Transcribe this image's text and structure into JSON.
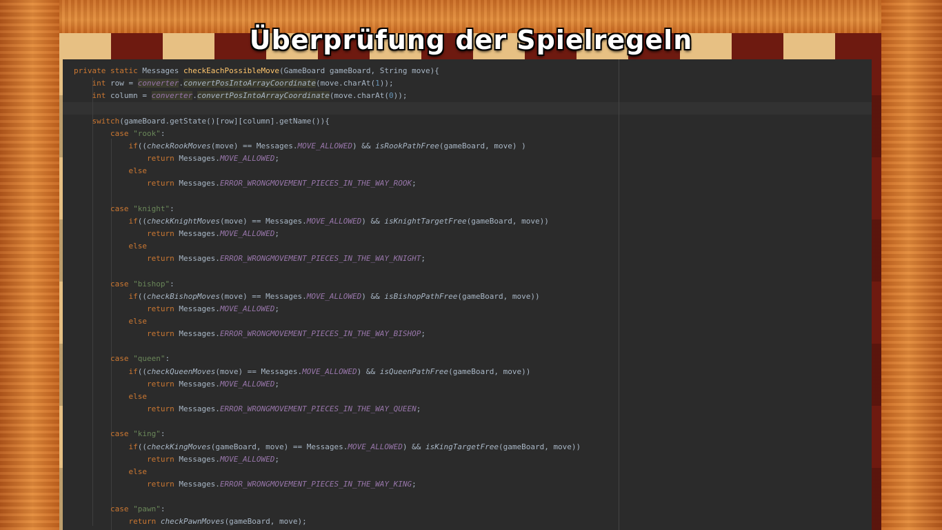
{
  "slide": {
    "title": "Überprüfung der Spielregeln"
  },
  "code": {
    "lines": [
      [
        [
          "kw",
          "private static "
        ],
        [
          "plain",
          "Messages "
        ],
        [
          "fn",
          "checkEachPossibleMove"
        ],
        [
          "plain",
          "(GameBoard gameBoard, String move){"
        ]
      ],
      [
        [
          "plain",
          "    "
        ],
        [
          "kw",
          "int "
        ],
        [
          "plain",
          "row = "
        ],
        [
          "field",
          "converter"
        ],
        [
          "plain",
          "."
        ],
        [
          "hlital",
          "convertPosIntoArrayCoordinate"
        ],
        [
          "plain",
          "(move.charAt("
        ],
        [
          "num",
          "1"
        ],
        [
          "plain",
          "));"
        ]
      ],
      [
        [
          "plain",
          "    "
        ],
        [
          "kw",
          "int "
        ],
        [
          "plain",
          "column = "
        ],
        [
          "field",
          "converter"
        ],
        [
          "plain",
          "."
        ],
        [
          "hlital",
          "convertPosIntoArrayCoordinate"
        ],
        [
          "plain",
          "(move.charAt("
        ],
        [
          "num",
          "0"
        ],
        [
          "plain",
          "));"
        ]
      ],
      [],
      [
        [
          "plain",
          "    "
        ],
        [
          "kw",
          "switch"
        ],
        [
          "plain",
          "(gameBoard.getState()[row][column].getName()){"
        ]
      ],
      [
        [
          "plain",
          "        "
        ],
        [
          "kw",
          "case "
        ],
        [
          "str",
          "\"rook\""
        ],
        [
          "plain",
          ":"
        ]
      ],
      [
        [
          "plain",
          "            "
        ],
        [
          "kw",
          "if"
        ],
        [
          "plain",
          "(("
        ],
        [
          "ital",
          "checkRookMoves"
        ],
        [
          "plain",
          "(move) == Messages."
        ],
        [
          "const",
          "MOVE_ALLOWED"
        ],
        [
          "plain",
          ") && "
        ],
        [
          "ital",
          "isRookPathFree"
        ],
        [
          "plain",
          "(gameBoard, move) )"
        ]
      ],
      [
        [
          "plain",
          "                "
        ],
        [
          "kw",
          "return "
        ],
        [
          "plain",
          "Messages."
        ],
        [
          "const",
          "MOVE_ALLOWED"
        ],
        [
          "plain",
          ";"
        ]
      ],
      [
        [
          "plain",
          "            "
        ],
        [
          "kw",
          "else"
        ]
      ],
      [
        [
          "plain",
          "                "
        ],
        [
          "kw",
          "return "
        ],
        [
          "plain",
          "Messages."
        ],
        [
          "const",
          "ERROR_WRONGMOVEMENT_PIECES_IN_THE_WAY_ROOK"
        ],
        [
          "plain",
          ";"
        ]
      ],
      [],
      [
        [
          "plain",
          "        "
        ],
        [
          "kw",
          "case "
        ],
        [
          "str",
          "\"knight\""
        ],
        [
          "plain",
          ":"
        ]
      ],
      [
        [
          "plain",
          "            "
        ],
        [
          "kw",
          "if"
        ],
        [
          "plain",
          "(("
        ],
        [
          "ital",
          "checkKnightMoves"
        ],
        [
          "plain",
          "(move) == Messages."
        ],
        [
          "const",
          "MOVE_ALLOWED"
        ],
        [
          "plain",
          ") && "
        ],
        [
          "ital",
          "isKnightTargetFree"
        ],
        [
          "plain",
          "(gameBoard, move))"
        ]
      ],
      [
        [
          "plain",
          "                "
        ],
        [
          "kw",
          "return "
        ],
        [
          "plain",
          "Messages."
        ],
        [
          "const",
          "MOVE_ALLOWED"
        ],
        [
          "plain",
          ";"
        ]
      ],
      [
        [
          "plain",
          "            "
        ],
        [
          "kw",
          "else"
        ]
      ],
      [
        [
          "plain",
          "                "
        ],
        [
          "kw",
          "return "
        ],
        [
          "plain",
          "Messages."
        ],
        [
          "const",
          "ERROR_WRONGMOVEMENT_PIECES_IN_THE_WAY_KNIGHT"
        ],
        [
          "plain",
          ";"
        ]
      ],
      [],
      [
        [
          "plain",
          "        "
        ],
        [
          "kw",
          "case "
        ],
        [
          "str",
          "\"bishop\""
        ],
        [
          "plain",
          ":"
        ]
      ],
      [
        [
          "plain",
          "            "
        ],
        [
          "kw",
          "if"
        ],
        [
          "plain",
          "(("
        ],
        [
          "ital",
          "checkBishopMoves"
        ],
        [
          "plain",
          "(move) == Messages."
        ],
        [
          "const",
          "MOVE_ALLOWED"
        ],
        [
          "plain",
          ") && "
        ],
        [
          "ital",
          "isBishopPathFree"
        ],
        [
          "plain",
          "(gameBoard, move))"
        ]
      ],
      [
        [
          "plain",
          "                "
        ],
        [
          "kw",
          "return "
        ],
        [
          "plain",
          "Messages."
        ],
        [
          "const",
          "MOVE_ALLOWED"
        ],
        [
          "plain",
          ";"
        ]
      ],
      [
        [
          "plain",
          "            "
        ],
        [
          "kw",
          "else"
        ]
      ],
      [
        [
          "plain",
          "                "
        ],
        [
          "kw",
          "return "
        ],
        [
          "plain",
          "Messages."
        ],
        [
          "const",
          "ERROR_WRONGMOVEMENT_PIECES_IN_THE_WAY_BISHOP"
        ],
        [
          "plain",
          ";"
        ]
      ],
      [],
      [
        [
          "plain",
          "        "
        ],
        [
          "kw",
          "case "
        ],
        [
          "str",
          "\"queen\""
        ],
        [
          "plain",
          ":"
        ]
      ],
      [
        [
          "plain",
          "            "
        ],
        [
          "kw",
          "if"
        ],
        [
          "plain",
          "(("
        ],
        [
          "ital",
          "checkQueenMoves"
        ],
        [
          "plain",
          "(move) == Messages."
        ],
        [
          "const",
          "MOVE_ALLOWED"
        ],
        [
          "plain",
          ") && "
        ],
        [
          "ital",
          "isQueenPathFree"
        ],
        [
          "plain",
          "(gameBoard, move))"
        ]
      ],
      [
        [
          "plain",
          "                "
        ],
        [
          "kw",
          "return "
        ],
        [
          "plain",
          "Messages."
        ],
        [
          "const",
          "MOVE_ALLOWED"
        ],
        [
          "plain",
          ";"
        ]
      ],
      [
        [
          "plain",
          "            "
        ],
        [
          "kw",
          "else"
        ]
      ],
      [
        [
          "plain",
          "                "
        ],
        [
          "kw",
          "return "
        ],
        [
          "plain",
          "Messages."
        ],
        [
          "const",
          "ERROR_WRONGMOVEMENT_PIECES_IN_THE_WAY_QUEEN"
        ],
        [
          "plain",
          ";"
        ]
      ],
      [],
      [
        [
          "plain",
          "        "
        ],
        [
          "kw",
          "case "
        ],
        [
          "str",
          "\"king\""
        ],
        [
          "plain",
          ":"
        ]
      ],
      [
        [
          "plain",
          "            "
        ],
        [
          "kw",
          "if"
        ],
        [
          "plain",
          "(("
        ],
        [
          "ital",
          "checkKingMoves"
        ],
        [
          "plain",
          "(gameBoard, move) == Messages."
        ],
        [
          "const",
          "MOVE_ALLOWED"
        ],
        [
          "plain",
          ") && "
        ],
        [
          "ital",
          "isKingTargetFree"
        ],
        [
          "plain",
          "(gameBoard, move))"
        ]
      ],
      [
        [
          "plain",
          "                "
        ],
        [
          "kw",
          "return "
        ],
        [
          "plain",
          "Messages."
        ],
        [
          "const",
          "MOVE_ALLOWED"
        ],
        [
          "plain",
          ";"
        ]
      ],
      [
        [
          "plain",
          "            "
        ],
        [
          "kw",
          "else"
        ]
      ],
      [
        [
          "plain",
          "                "
        ],
        [
          "kw",
          "return "
        ],
        [
          "plain",
          "Messages."
        ],
        [
          "const",
          "ERROR_WRONGMOVEMENT_PIECES_IN_THE_WAY_KING"
        ],
        [
          "plain",
          ";"
        ]
      ],
      [],
      [
        [
          "plain",
          "        "
        ],
        [
          "kw",
          "case "
        ],
        [
          "str",
          "\"pawn\""
        ],
        [
          "plain",
          ":"
        ]
      ],
      [
        [
          "plain",
          "            "
        ],
        [
          "kw",
          "return "
        ],
        [
          "ital",
          "checkPawnMoves"
        ],
        [
          "plain",
          "(gameBoard, move);"
        ]
      ]
    ]
  },
  "colors": {
    "editor_bg": "#2b2b2b",
    "keyword": "#cc7832",
    "method_decl": "#ffc66d",
    "string": "#6a8759",
    "number": "#6897bb",
    "constant": "#9876aa",
    "plain": "#a9b7c6"
  }
}
